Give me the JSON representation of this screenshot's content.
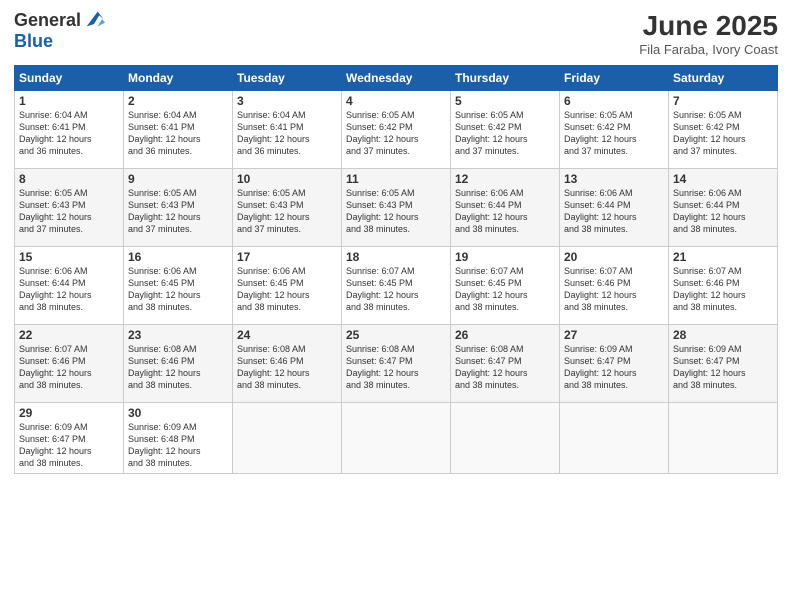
{
  "logo": {
    "general": "General",
    "blue": "Blue"
  },
  "title": "June 2025",
  "subtitle": "Fila Faraba, Ivory Coast",
  "days": [
    "Sunday",
    "Monday",
    "Tuesday",
    "Wednesday",
    "Thursday",
    "Friday",
    "Saturday"
  ],
  "weeks": [
    [
      {
        "day": "1",
        "sunrise": "6:04 AM",
        "sunset": "6:41 PM",
        "daylight": "12 hours and 36 minutes."
      },
      {
        "day": "2",
        "sunrise": "6:04 AM",
        "sunset": "6:41 PM",
        "daylight": "12 hours and 36 minutes."
      },
      {
        "day": "3",
        "sunrise": "6:04 AM",
        "sunset": "6:41 PM",
        "daylight": "12 hours and 36 minutes."
      },
      {
        "day": "4",
        "sunrise": "6:05 AM",
        "sunset": "6:42 PM",
        "daylight": "12 hours and 37 minutes."
      },
      {
        "day": "5",
        "sunrise": "6:05 AM",
        "sunset": "6:42 PM",
        "daylight": "12 hours and 37 minutes."
      },
      {
        "day": "6",
        "sunrise": "6:05 AM",
        "sunset": "6:42 PM",
        "daylight": "12 hours and 37 minutes."
      },
      {
        "day": "7",
        "sunrise": "6:05 AM",
        "sunset": "6:42 PM",
        "daylight": "12 hours and 37 minutes."
      }
    ],
    [
      {
        "day": "8",
        "sunrise": "6:05 AM",
        "sunset": "6:43 PM",
        "daylight": "12 hours and 37 minutes."
      },
      {
        "day": "9",
        "sunrise": "6:05 AM",
        "sunset": "6:43 PM",
        "daylight": "12 hours and 37 minutes."
      },
      {
        "day": "10",
        "sunrise": "6:05 AM",
        "sunset": "6:43 PM",
        "daylight": "12 hours and 37 minutes."
      },
      {
        "day": "11",
        "sunrise": "6:05 AM",
        "sunset": "6:43 PM",
        "daylight": "12 hours and 38 minutes."
      },
      {
        "day": "12",
        "sunrise": "6:06 AM",
        "sunset": "6:44 PM",
        "daylight": "12 hours and 38 minutes."
      },
      {
        "day": "13",
        "sunrise": "6:06 AM",
        "sunset": "6:44 PM",
        "daylight": "12 hours and 38 minutes."
      },
      {
        "day": "14",
        "sunrise": "6:06 AM",
        "sunset": "6:44 PM",
        "daylight": "12 hours and 38 minutes."
      }
    ],
    [
      {
        "day": "15",
        "sunrise": "6:06 AM",
        "sunset": "6:44 PM",
        "daylight": "12 hours and 38 minutes."
      },
      {
        "day": "16",
        "sunrise": "6:06 AM",
        "sunset": "6:45 PM",
        "daylight": "12 hours and 38 minutes."
      },
      {
        "day": "17",
        "sunrise": "6:06 AM",
        "sunset": "6:45 PM",
        "daylight": "12 hours and 38 minutes."
      },
      {
        "day": "18",
        "sunrise": "6:07 AM",
        "sunset": "6:45 PM",
        "daylight": "12 hours and 38 minutes."
      },
      {
        "day": "19",
        "sunrise": "6:07 AM",
        "sunset": "6:45 PM",
        "daylight": "12 hours and 38 minutes."
      },
      {
        "day": "20",
        "sunrise": "6:07 AM",
        "sunset": "6:46 PM",
        "daylight": "12 hours and 38 minutes."
      },
      {
        "day": "21",
        "sunrise": "6:07 AM",
        "sunset": "6:46 PM",
        "daylight": "12 hours and 38 minutes."
      }
    ],
    [
      {
        "day": "22",
        "sunrise": "6:07 AM",
        "sunset": "6:46 PM",
        "daylight": "12 hours and 38 minutes."
      },
      {
        "day": "23",
        "sunrise": "6:08 AM",
        "sunset": "6:46 PM",
        "daylight": "12 hours and 38 minutes."
      },
      {
        "day": "24",
        "sunrise": "6:08 AM",
        "sunset": "6:46 PM",
        "daylight": "12 hours and 38 minutes."
      },
      {
        "day": "25",
        "sunrise": "6:08 AM",
        "sunset": "6:47 PM",
        "daylight": "12 hours and 38 minutes."
      },
      {
        "day": "26",
        "sunrise": "6:08 AM",
        "sunset": "6:47 PM",
        "daylight": "12 hours and 38 minutes."
      },
      {
        "day": "27",
        "sunrise": "6:09 AM",
        "sunset": "6:47 PM",
        "daylight": "12 hours and 38 minutes."
      },
      {
        "day": "28",
        "sunrise": "6:09 AM",
        "sunset": "6:47 PM",
        "daylight": "12 hours and 38 minutes."
      }
    ],
    [
      {
        "day": "29",
        "sunrise": "6:09 AM",
        "sunset": "6:47 PM",
        "daylight": "12 hours and 38 minutes."
      },
      {
        "day": "30",
        "sunrise": "6:09 AM",
        "sunset": "6:48 PM",
        "daylight": "12 hours and 38 minutes."
      },
      null,
      null,
      null,
      null,
      null
    ]
  ]
}
